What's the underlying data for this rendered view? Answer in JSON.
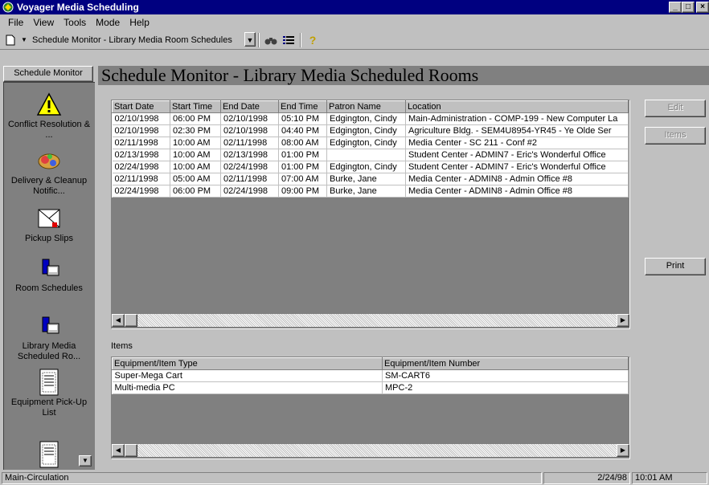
{
  "window": {
    "title": "Voyager Media Scheduling",
    "controls": [
      "_",
      "□",
      "×"
    ]
  },
  "menu": [
    "File",
    "View",
    "Tools",
    "Mode",
    "Help"
  ],
  "toolbar": {
    "new_icon": "new-document-icon",
    "view_select_value": "Schedule Monitor - Library Media Room Schedules",
    "find_icon": "binoculars-icon",
    "list_icon": "list-icon",
    "help_icon": "question-mark-icon"
  },
  "sidebar": {
    "header": "Schedule Monitor",
    "items": [
      {
        "label": "Conflict Resolution & ...",
        "icon": "warning-icon"
      },
      {
        "label": "Delivery & Cleanup Notific...",
        "icon": "delivery-icon"
      },
      {
        "label": "Pickup Slips",
        "icon": "pickup-slip-icon"
      },
      {
        "label": "Room Schedules",
        "icon": "room-schedule-icon"
      },
      {
        "label": "Library Media Scheduled Ro...",
        "icon": "library-media-icon"
      },
      {
        "label": "Equipment Pick-Up List",
        "icon": "equipment-list-icon"
      },
      {
        "label": "",
        "icon": "document-icon"
      }
    ]
  },
  "page_title": "Schedule Monitor - Library Media Scheduled Rooms",
  "schedule": {
    "columns": [
      "Start Date",
      "Start Time",
      "End Date",
      "End Time",
      "Patron Name",
      "Location"
    ],
    "rows": [
      [
        "02/10/1998",
        "06:00 PM",
        "02/10/1998",
        "05:10 PM",
        "Edgington, Cindy",
        "Main-Administration - COMP-199 - New Computer La"
      ],
      [
        "02/10/1998",
        "02:30 PM",
        "02/10/1998",
        "04:40 PM",
        "Edgington, Cindy",
        "Agriculture Bldg. - SEM4U8954-YR45 - Ye Olde Ser"
      ],
      [
        "02/11/1998",
        "10:00 AM",
        "02/11/1998",
        "08:00 AM",
        "Edgington, Cindy",
        "Media Center - SC 211 - Conf #2"
      ],
      [
        "02/13/1998",
        "10:00 AM",
        "02/13/1998",
        "01:00 PM",
        "",
        "Student Center - ADMIN7 - Eric's Wonderful Office"
      ],
      [
        "02/24/1998",
        "10:00 AM",
        "02/24/1998",
        "01:00 PM",
        "Edgington, Cindy",
        "Student Center - ADMIN7 - Eric's Wonderful Office"
      ],
      [
        "02/11/1998",
        "05:00 AM",
        "02/11/1998",
        "07:00 AM",
        "Burke, Jane",
        "Media Center - ADMIN8 - Admin Office #8"
      ],
      [
        "02/24/1998",
        "06:00 PM",
        "02/24/1998",
        "09:00 PM",
        "Burke, Jane",
        "Media Center - ADMIN8 - Admin Office #8"
      ]
    ]
  },
  "items": {
    "label": "Items",
    "columns": [
      "Equipment/Item Type",
      "Equipment/Item Number"
    ],
    "rows": [
      [
        "Super-Mega Cart",
        "SM-CART6"
      ],
      [
        "Multi-media PC",
        "MPC-2"
      ]
    ]
  },
  "actions": {
    "edit": "Edit",
    "items": "Items",
    "print": "Print"
  },
  "status": {
    "mode": "Main-Circulation",
    "date": "2/24/98",
    "time": "10:01 AM"
  },
  "colors": {
    "titlebar": "#000080",
    "face": "#c0c0c0",
    "dark": "#808080"
  }
}
